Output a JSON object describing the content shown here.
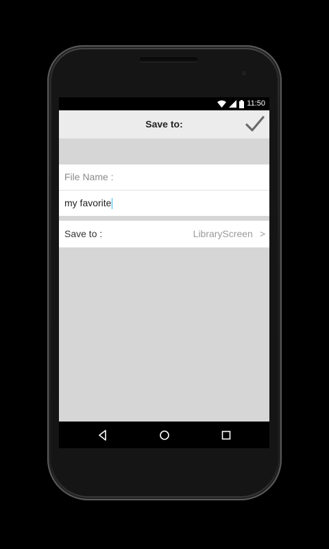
{
  "status_bar": {
    "time": "11:50",
    "icons": [
      "wifi-icon",
      "signal-icon",
      "battery-icon"
    ]
  },
  "action_bar": {
    "title": "Save to:",
    "confirm_icon": "checkmark-icon"
  },
  "form": {
    "file_name_label": "File Name :",
    "file_name_value": "my favorite",
    "save_to_label": "Save to :",
    "save_to_value": "LibraryScreen",
    "save_to_chevron": ">"
  },
  "nav_bar": {
    "icons": [
      "back-icon",
      "home-icon",
      "recents-icon"
    ]
  },
  "colors": {
    "background": "#d6d6d6",
    "panel": "#ffffff",
    "caret": "#33b5e5",
    "action_bar": "#ececec"
  }
}
